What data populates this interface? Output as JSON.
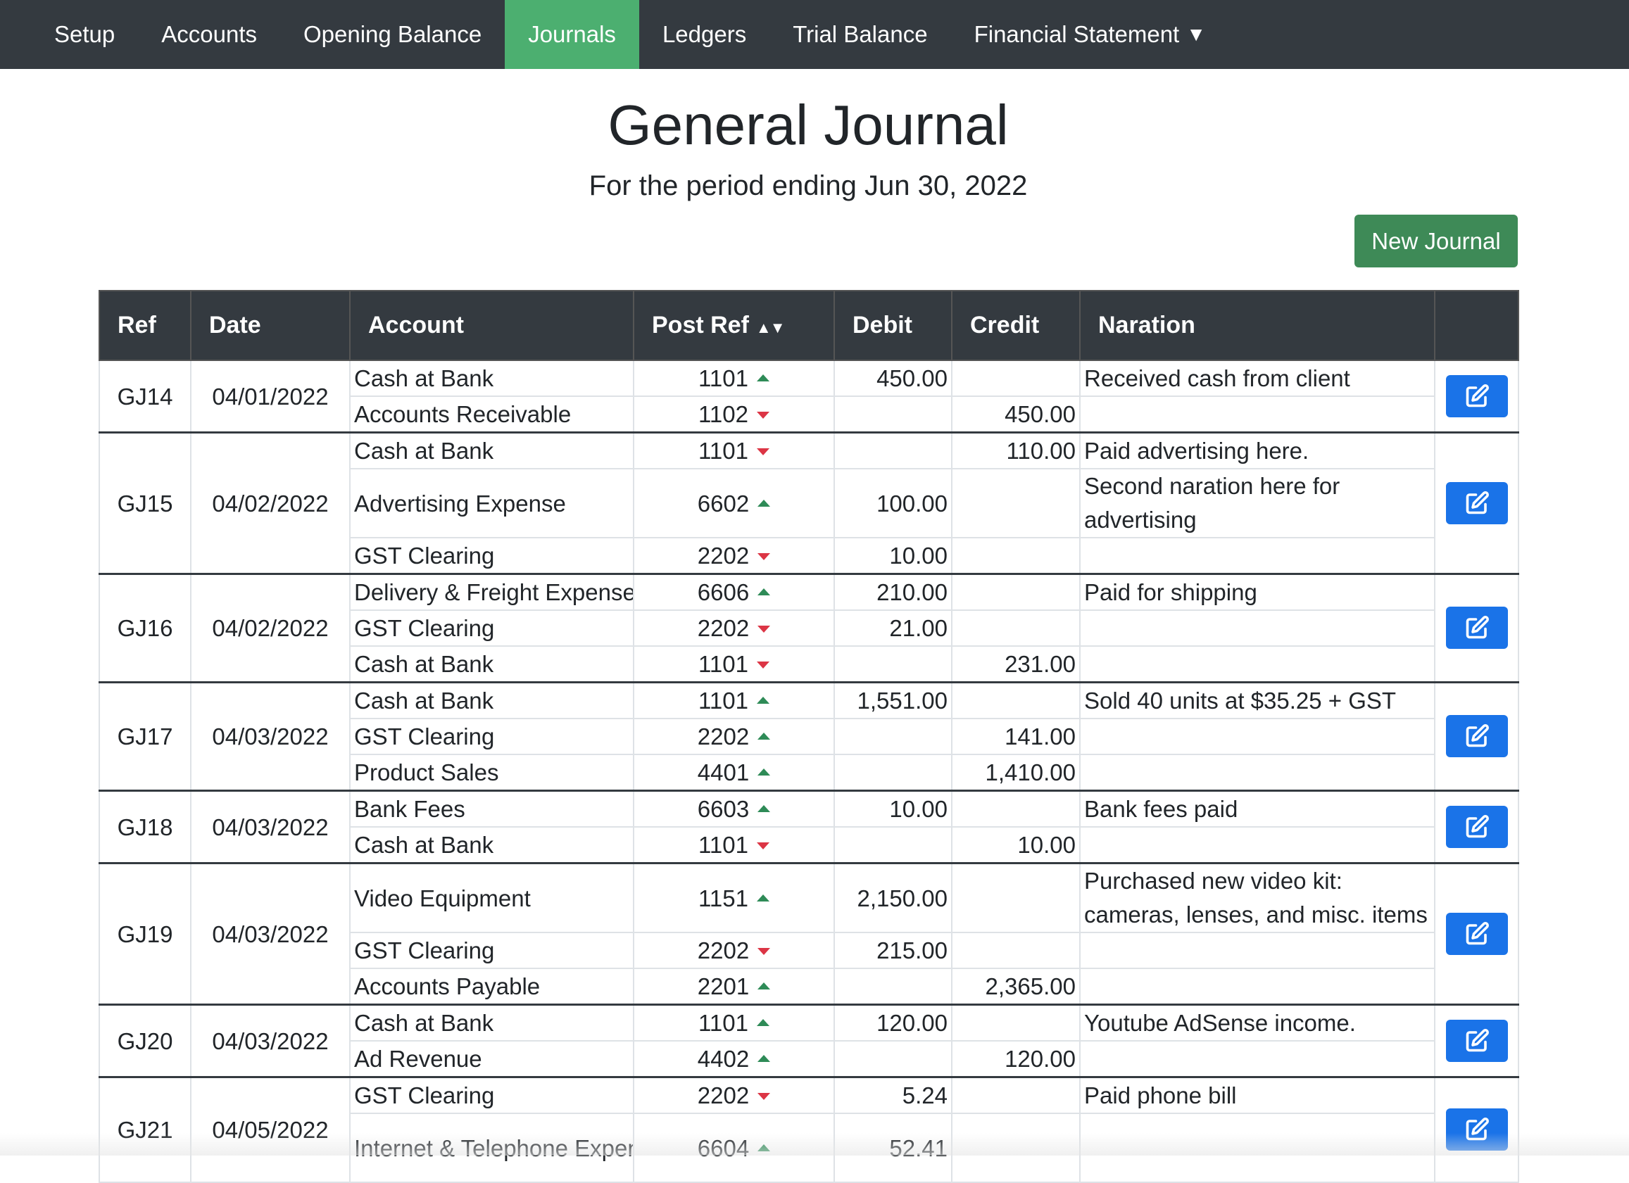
{
  "nav": {
    "items": [
      {
        "label": "Setup",
        "active": false
      },
      {
        "label": "Accounts",
        "active": false
      },
      {
        "label": "Opening Balance",
        "active": false
      },
      {
        "label": "Journals",
        "active": true
      },
      {
        "label": "Ledgers",
        "active": false
      },
      {
        "label": "Trial Balance",
        "active": false
      },
      {
        "label": "Financial Statement",
        "active": false,
        "dropdown": true,
        "caret": "▼"
      }
    ]
  },
  "header": {
    "title": "General Journal",
    "subtitle": "For the period ending Jun 30, 2022",
    "new_button": "New Journal"
  },
  "table": {
    "columns": [
      "Ref",
      "Date",
      "Account",
      "Post Ref",
      "Debit",
      "Credit",
      "Naration"
    ],
    "journals": [
      {
        "ref": "GJ14",
        "date": "04/01/2022",
        "lines": [
          {
            "account": "Cash at Bank",
            "post_ref": "1101",
            "dir": "up",
            "debit": "450.00",
            "credit": "",
            "narration": "Received cash from client"
          },
          {
            "account": "Accounts Receivable",
            "post_ref": "1102",
            "dir": "down",
            "debit": "",
            "credit": "450.00",
            "narration": ""
          }
        ]
      },
      {
        "ref": "GJ15",
        "date": "04/02/2022",
        "lines": [
          {
            "account": "Cash at Bank",
            "post_ref": "1101",
            "dir": "down",
            "debit": "",
            "credit": "110.00",
            "narration": "Paid advertising here."
          },
          {
            "account": "Advertising Expense",
            "post_ref": "6602",
            "dir": "up",
            "debit": "100.00",
            "credit": "",
            "narration": "Second naration here for advertising",
            "tall": true
          },
          {
            "account": "GST Clearing",
            "post_ref": "2202",
            "dir": "down",
            "debit": "10.00",
            "credit": "",
            "narration": ""
          }
        ]
      },
      {
        "ref": "GJ16",
        "date": "04/02/2022",
        "lines": [
          {
            "account": "Delivery & Freight Expense",
            "post_ref": "6606",
            "dir": "up",
            "debit": "210.00",
            "credit": "",
            "narration": "Paid for shipping"
          },
          {
            "account": "GST Clearing",
            "post_ref": "2202",
            "dir": "down",
            "debit": "21.00",
            "credit": "",
            "narration": ""
          },
          {
            "account": "Cash at Bank",
            "post_ref": "1101",
            "dir": "down",
            "debit": "",
            "credit": "231.00",
            "narration": ""
          }
        ]
      },
      {
        "ref": "GJ17",
        "date": "04/03/2022",
        "lines": [
          {
            "account": "Cash at Bank",
            "post_ref": "1101",
            "dir": "up",
            "debit": "1,551.00",
            "credit": "",
            "narration": "Sold 40 units at $35.25 + GST"
          },
          {
            "account": "GST Clearing",
            "post_ref": "2202",
            "dir": "up",
            "debit": "",
            "credit": "141.00",
            "narration": ""
          },
          {
            "account": "Product Sales",
            "post_ref": "4401",
            "dir": "up",
            "debit": "",
            "credit": "1,410.00",
            "narration": ""
          }
        ]
      },
      {
        "ref": "GJ18",
        "date": "04/03/2022",
        "lines": [
          {
            "account": "Bank Fees",
            "post_ref": "6603",
            "dir": "up",
            "debit": "10.00",
            "credit": "",
            "narration": "Bank fees paid"
          },
          {
            "account": "Cash at Bank",
            "post_ref": "1101",
            "dir": "down",
            "debit": "",
            "credit": "10.00",
            "narration": ""
          }
        ]
      },
      {
        "ref": "GJ19",
        "date": "04/03/2022",
        "lines": [
          {
            "account": "Video Equipment",
            "post_ref": "1151",
            "dir": "up",
            "debit": "2,150.00",
            "credit": "",
            "narration": "Purchased new video kit: cameras, lenses, and misc. items",
            "tall": true
          },
          {
            "account": "GST Clearing",
            "post_ref": "2202",
            "dir": "down",
            "debit": "215.00",
            "credit": "",
            "narration": ""
          },
          {
            "account": "Accounts Payable",
            "post_ref": "2201",
            "dir": "up",
            "debit": "",
            "credit": "2,365.00",
            "narration": ""
          }
        ]
      },
      {
        "ref": "GJ20",
        "date": "04/03/2022",
        "lines": [
          {
            "account": "Cash at Bank",
            "post_ref": "1101",
            "dir": "up",
            "debit": "120.00",
            "credit": "",
            "narration": "Youtube AdSense income."
          },
          {
            "account": "Ad Revenue",
            "post_ref": "4402",
            "dir": "up",
            "debit": "",
            "credit": "120.00",
            "narration": ""
          }
        ]
      },
      {
        "ref": "GJ21",
        "date": "04/05/2022",
        "lines": [
          {
            "account": "GST Clearing",
            "post_ref": "2202",
            "dir": "down",
            "debit": "5.24",
            "credit": "",
            "narration": "Paid phone bill"
          },
          {
            "account": "Internet & Telephone Expense",
            "post_ref": "6604",
            "dir": "up",
            "debit": "52.41",
            "credit": "",
            "narration": "",
            "tall": true
          }
        ]
      }
    ]
  },
  "colors": {
    "navbar": "#343a40",
    "active_tab": "#4caf70",
    "new_button": "#3e8a57",
    "edit_button": "#1a73e8",
    "arrow_up": "#2e8b57",
    "arrow_down": "#dc3545"
  },
  "icons": {
    "edit": "edit-square-icon",
    "sort": "sort-icon",
    "up": "arrow-up-icon",
    "down": "arrow-down-icon"
  }
}
